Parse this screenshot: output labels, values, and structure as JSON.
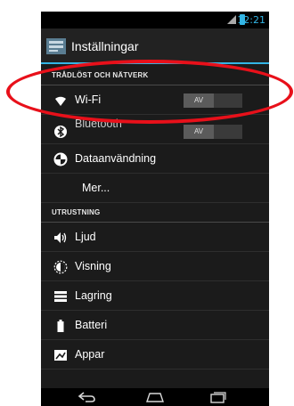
{
  "status_bar": {
    "time": "12:21"
  },
  "action_bar": {
    "title": "Inställningar",
    "icon": "settings-app-icon"
  },
  "sections": {
    "wireless_header": "TRÅDLÖST OCH NÄTVERK",
    "device_header": "UTRUSTNING"
  },
  "items": {
    "wifi": {
      "label": "Wi-Fi",
      "toggle": "AV",
      "icon": "wifi-icon"
    },
    "bluetooth": {
      "label": "Bluetooth",
      "toggle": "AV",
      "icon": "bluetooth-icon"
    },
    "data": {
      "label": "Dataanvändning",
      "icon": "data-usage-icon"
    },
    "more": {
      "label": "Mer..."
    },
    "sound": {
      "label": "Ljud",
      "icon": "volume-icon"
    },
    "display": {
      "label": "Visning",
      "icon": "brightness-icon"
    },
    "storage": {
      "label": "Lagring",
      "icon": "storage-icon"
    },
    "battery": {
      "label": "Batteri",
      "icon": "battery-icon"
    },
    "apps": {
      "label": "Appar",
      "icon": "apps-icon"
    }
  },
  "colors": {
    "accent": "#33b5e5",
    "annotation": "#e8101a",
    "background": "#1b1b1b"
  }
}
